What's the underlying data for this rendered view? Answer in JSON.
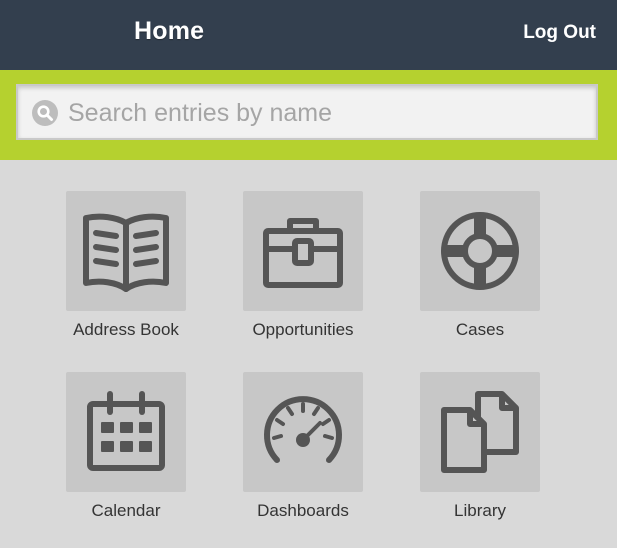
{
  "header": {
    "title": "Home",
    "logout_label": "Log Out"
  },
  "search": {
    "placeholder": "Search entries by name",
    "value": ""
  },
  "tiles": [
    {
      "label": "Address Book",
      "icon": "book-icon"
    },
    {
      "label": "Opportunities",
      "icon": "briefcase-icon"
    },
    {
      "label": "Cases",
      "icon": "lifebuoy-icon"
    },
    {
      "label": "Calendar",
      "icon": "calendar-icon"
    },
    {
      "label": "Dashboards",
      "icon": "speedometer-icon"
    },
    {
      "label": "Library",
      "icon": "documents-icon"
    }
  ],
  "colors": {
    "header_bg": "#333f4e",
    "accent_green": "#b5d12f",
    "page_bg": "#d9d9d9",
    "tile_bg": "#c7c7c7",
    "icon_color": "#555555"
  }
}
